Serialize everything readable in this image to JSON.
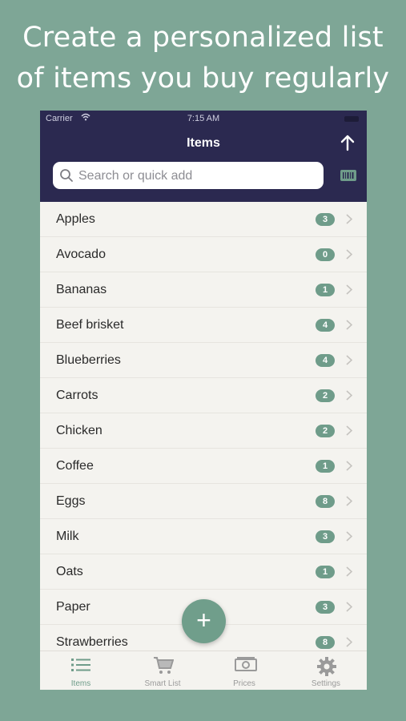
{
  "headline": {
    "line1": "Create a personalized list",
    "line2": "of items you buy regularly"
  },
  "status_bar": {
    "carrier": "Carrier",
    "time": "7:15 AM"
  },
  "nav": {
    "title": "Items"
  },
  "search": {
    "placeholder": "Search or quick add"
  },
  "colors": {
    "background": "#7ea696",
    "navbar": "#2b2950",
    "accent": "#6f9c8a"
  },
  "items": [
    {
      "name": "Apples",
      "count": "3"
    },
    {
      "name": "Avocado",
      "count": "0"
    },
    {
      "name": "Bananas",
      "count": "1"
    },
    {
      "name": "Beef brisket",
      "count": "4"
    },
    {
      "name": "Blueberries",
      "count": "4"
    },
    {
      "name": "Carrots",
      "count": "2"
    },
    {
      "name": "Chicken",
      "count": "2"
    },
    {
      "name": "Coffee",
      "count": "1"
    },
    {
      "name": "Eggs",
      "count": "8"
    },
    {
      "name": "Milk",
      "count": "3"
    },
    {
      "name": "Oats",
      "count": "1"
    },
    {
      "name": "Paper",
      "count": "3"
    },
    {
      "name": "Strawberries",
      "count": "8"
    }
  ],
  "fab": {
    "label": "+"
  },
  "tabs": [
    {
      "label": "Items",
      "icon": "list-icon"
    },
    {
      "label": "Smart List",
      "icon": "cart-icon"
    },
    {
      "label": "Prices",
      "icon": "money-icon"
    },
    {
      "label": "Settings",
      "icon": "gear-icon"
    }
  ]
}
